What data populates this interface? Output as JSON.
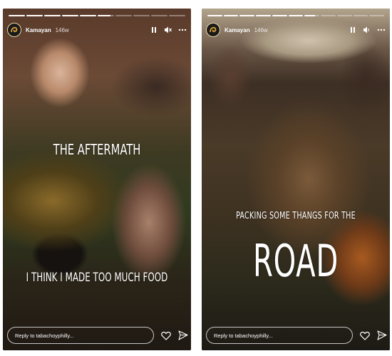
{
  "stories": [
    {
      "id": "left",
      "progress": [
        1,
        1,
        1,
        1,
        1,
        0.8,
        0,
        0,
        0,
        0
      ],
      "username": "Kamayan",
      "timestamp": "146w",
      "caption_lines": [
        "THE AFTERMATH",
        "I THINK I MADE TOO MUCH FOOD"
      ],
      "reply_placeholder": "Reply to tabachoyphilly...",
      "icons": [
        "avatar-icon",
        "pause-icon",
        "mute-icon",
        "more-icon",
        "heart-icon",
        "send-icon"
      ]
    },
    {
      "id": "right",
      "progress": [
        1,
        1,
        1,
        1,
        1,
        1,
        0.7,
        0,
        0,
        0,
        0
      ],
      "username": "Kamayan",
      "timestamp": "146w",
      "caption_lines": [
        "PACKING SOME THANGS FOR THE",
        "ROAD"
      ],
      "reply_placeholder": "Reply to tabachoyphilly...",
      "icons": [
        "avatar-icon",
        "pause-icon",
        "volume-icon",
        "more-icon",
        "heart-icon",
        "send-icon"
      ]
    }
  ],
  "colors": {
    "text": "#ffffff",
    "avatar_ring": "#e9d8a6",
    "avatar_mark": "#e0a23a"
  }
}
